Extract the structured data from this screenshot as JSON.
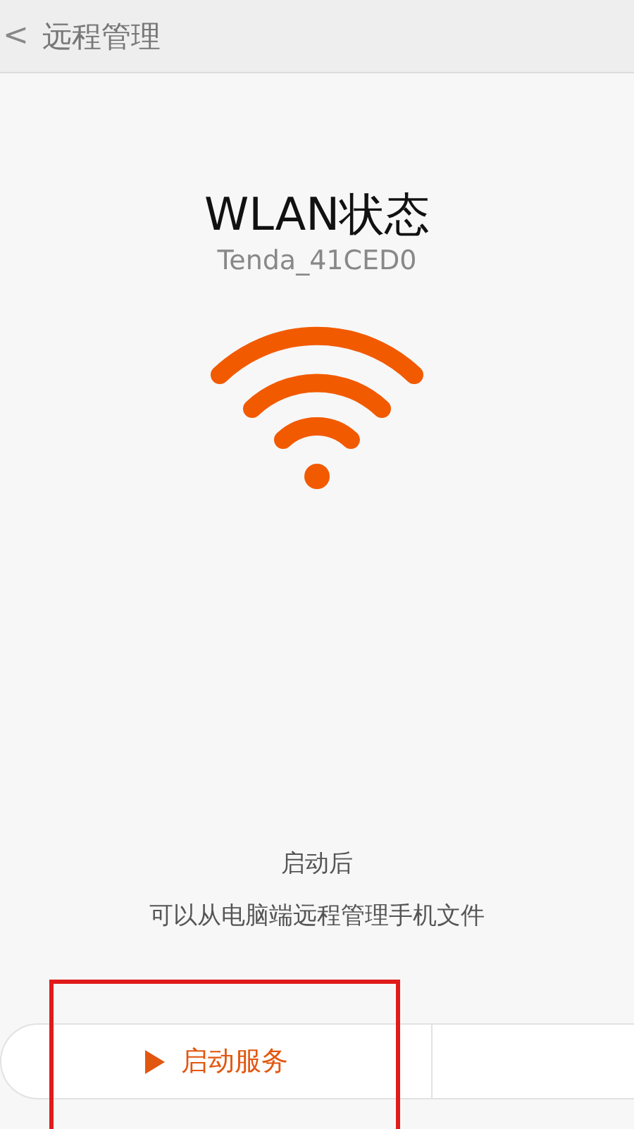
{
  "header": {
    "back_icon": "<",
    "title": "远程管理"
  },
  "status": {
    "title": "WLAN状态",
    "ssid": "Tenda_41CED0"
  },
  "description": [
    "启动后",
    "可以从电脑端远程管理手机文件"
  ],
  "action": {
    "label": "启动服务",
    "highlighted": true
  }
}
